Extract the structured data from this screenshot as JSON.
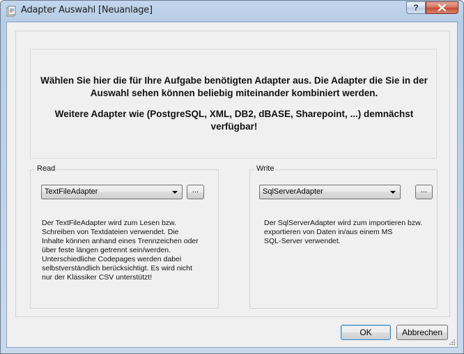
{
  "window": {
    "title": "Adapter Auswahl [Neuanlage]",
    "help_label": "?"
  },
  "info": {
    "line1": "Wählen Sie hier die für Ihre Aufgabe benötigten Adapter aus. Die Adapter die Sie in der Auswahl sehen können beliebig miteinander kombiniert werden.",
    "line2": "Weitere Adapter wie (PostgreSQL, XML, DB2, dBASE, Sharepoint, ...) demnächst verfügbar!"
  },
  "read": {
    "label": "Read",
    "selected": "TextFileAdapter",
    "browse_label": "...",
    "description": "Der TextFileAdapter wird zum Lesen bzw.\nSchreiben von Textdateien verwendet. Die\nInhalte können anhand eines Trennzeichen oder\nüber feste längen getrennt sein/werden.\nUnterschiedliche Codepages werden dabei\nselbstverständlich berücksichtigt. Es wird nicht\nnur der Klassiker CSV unterstützt!"
  },
  "write": {
    "label": "Write",
    "selected": "SqlServerAdapter",
    "browse_label": "...",
    "description": "Der SqlServerAdapter wird zum importieren bzw.\nexportieren von Daten in/aus einem MS\nSQL-Server verwendet."
  },
  "buttons": {
    "ok": "OK",
    "cancel": "Abbrechen"
  },
  "colors": {
    "title_bar": "#b7cce6",
    "close_button": "#c54b34",
    "dialog_background": "#f0f0f0",
    "ok_focus_border": "#3c7fb1"
  }
}
